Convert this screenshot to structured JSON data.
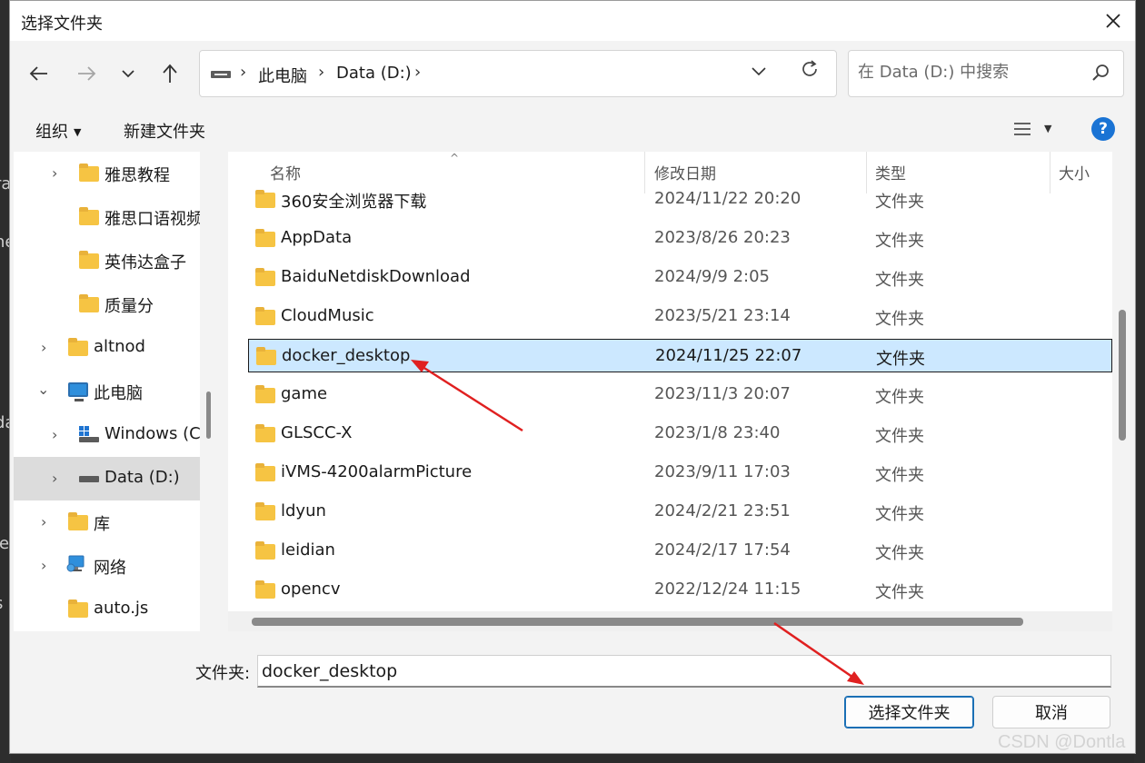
{
  "window": {
    "title": "选择文件夹"
  },
  "address": {
    "crumbs": [
      "此电脑",
      "Data (D:)"
    ]
  },
  "search": {
    "placeholder": "在 Data (D:) 中搜索"
  },
  "toolbar": {
    "organize": "组织",
    "new_folder": "新建文件夹"
  },
  "sidebar": {
    "items": [
      {
        "label": "雅思教程",
        "icon": "folder-icon",
        "expandable": true
      },
      {
        "label": "雅思口语视频",
        "icon": "folder-icon",
        "expandable": false
      },
      {
        "label": "英伟达盒子",
        "icon": "folder-icon",
        "expandable": false
      },
      {
        "label": "质量分",
        "icon": "folder-icon",
        "expandable": false
      },
      {
        "label": "altnod",
        "icon": "folder-icon",
        "expandable": true
      },
      {
        "label": "此电脑",
        "icon": "pc-icon",
        "expanded": true
      },
      {
        "label": "Windows (C:)",
        "icon": "windows-drive-icon",
        "expandable": true
      },
      {
        "label": "Data (D:)",
        "icon": "drive-icon",
        "expandable": true,
        "selected": true
      },
      {
        "label": "库",
        "icon": "folder-icon",
        "expandable": true
      },
      {
        "label": "网络",
        "icon": "network-icon",
        "expandable": true
      },
      {
        "label": "auto.js",
        "icon": "folder-icon",
        "expandable": false
      }
    ]
  },
  "columns": {
    "name": "名称",
    "date": "修改日期",
    "type": "类型",
    "size": "大小"
  },
  "files": [
    {
      "name": "360安全浏览器下载",
      "date": "2024/11/22 20:20",
      "type": "文件夹"
    },
    {
      "name": "AppData",
      "date": "2023/8/26 20:23",
      "type": "文件夹"
    },
    {
      "name": "BaiduNetdiskDownload",
      "date": "2024/9/9 2:05",
      "type": "文件夹"
    },
    {
      "name": "CloudMusic",
      "date": "2023/5/21 23:14",
      "type": "文件夹"
    },
    {
      "name": "docker_desktop",
      "date": "2024/11/25 22:07",
      "type": "文件夹",
      "selected": true
    },
    {
      "name": "game",
      "date": "2023/11/3 20:07",
      "type": "文件夹"
    },
    {
      "name": "GLSCC-X",
      "date": "2023/1/8 23:40",
      "type": "文件夹"
    },
    {
      "name": "iVMS-4200alarmPicture",
      "date": "2023/9/11 17:03",
      "type": "文件夹"
    },
    {
      "name": "ldyun",
      "date": "2024/2/21 23:51",
      "type": "文件夹"
    },
    {
      "name": "leidian",
      "date": "2024/2/17 17:54",
      "type": "文件夹"
    },
    {
      "name": "opencv",
      "date": "2022/12/24 11:15",
      "type": "文件夹"
    }
  ],
  "footer": {
    "folder_label": "文件夹:",
    "folder_value": "docker_desktop",
    "select_button": "选择文件夹",
    "cancel_button": "取消"
  },
  "watermark": "CSDN @Dontla",
  "colors": {
    "selection": "#cce8ff",
    "accent": "#1a6fb5",
    "annotation": "#e02020"
  }
}
